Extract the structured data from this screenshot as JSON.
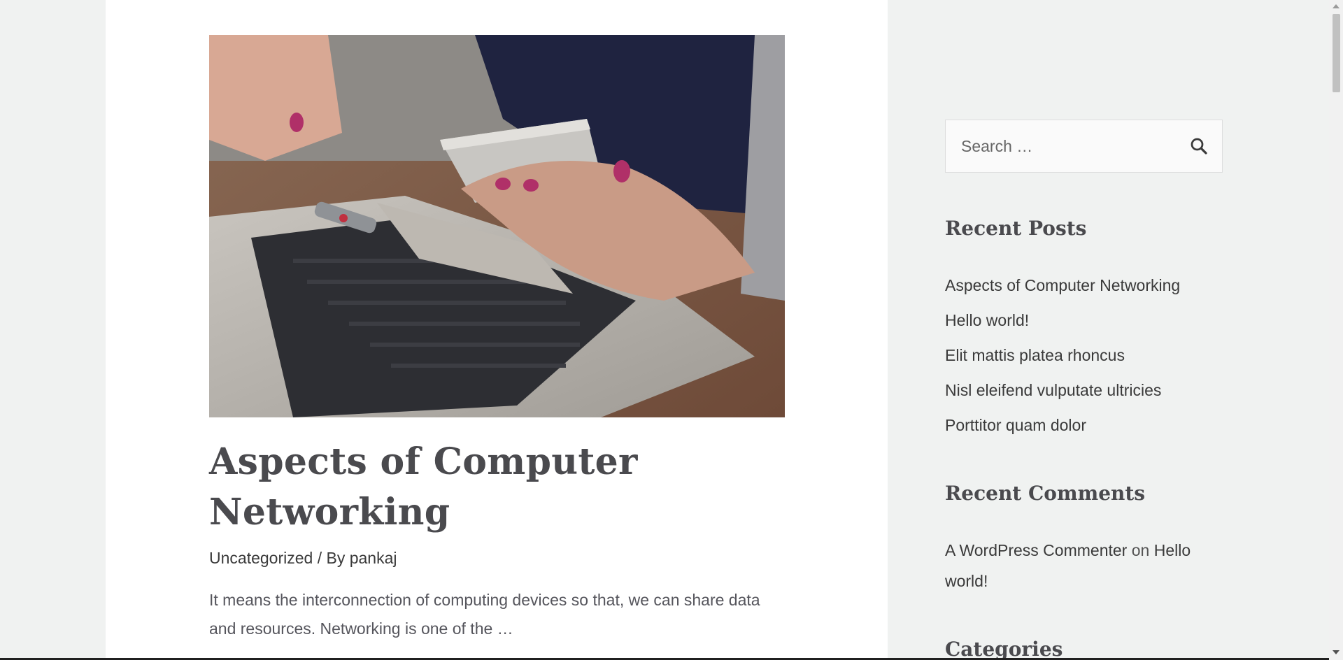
{
  "post": {
    "title": "Aspects of Computer Networking",
    "category": "Uncategorized",
    "separator": " / By ",
    "author": "pankaj",
    "excerpt": "It means the interconnection of computing devices so that, we can share data and resources. Networking is one of the …",
    "image_subject": "hands holding smartphone over laptop with USB drive"
  },
  "sidebar": {
    "search": {
      "placeholder": "Search …",
      "icon": "search-icon"
    },
    "recent_posts": {
      "title": "Recent Posts",
      "items": [
        "Aspects of Computer Networking",
        "Hello world!",
        "Elit mattis platea rhoncus",
        "Nisl eleifend vulputate ultricies",
        "Porttitor quam dolor"
      ]
    },
    "recent_comments": {
      "title": "Recent Comments",
      "author": "A WordPress Commenter",
      "on": " on ",
      "post": "Hello world!"
    },
    "categories": {
      "title": "Categories"
    }
  },
  "colors": {
    "page_bg": "#f0f2f1",
    "card_bg": "#ffffff",
    "heading": "#4a4a4e",
    "text": "#3a3a3a"
  }
}
